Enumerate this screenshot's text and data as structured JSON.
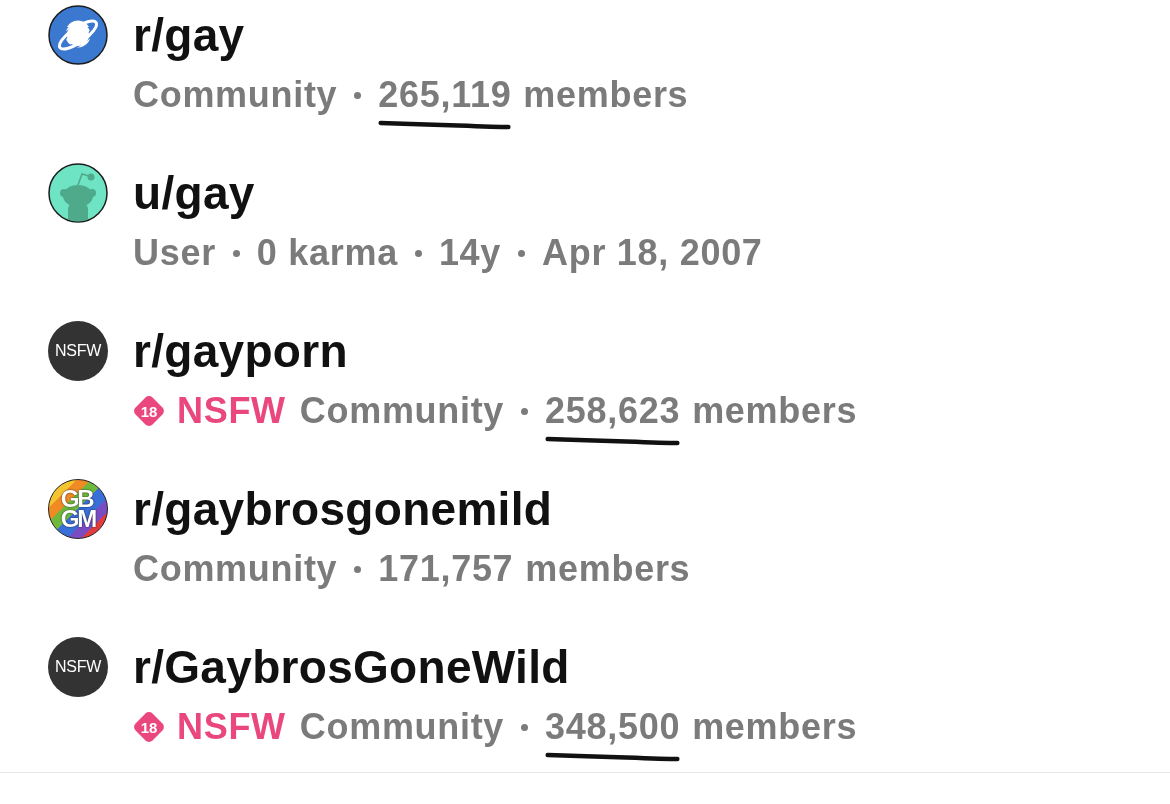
{
  "results": [
    {
      "avatar": {
        "kind": "planet"
      },
      "name": "r/gay",
      "meta": [
        {
          "kind": "text",
          "text": "Community"
        },
        {
          "kind": "count",
          "value": "265,119",
          "unit": "members",
          "underlined": true
        }
      ]
    },
    {
      "avatar": {
        "kind": "mascot"
      },
      "name": "u/gay",
      "meta": [
        {
          "kind": "text",
          "text": "User"
        },
        {
          "kind": "text",
          "text": "0 karma"
        },
        {
          "kind": "text",
          "text": "14y"
        },
        {
          "kind": "text",
          "text": "Apr 18, 2007"
        }
      ]
    },
    {
      "avatar": {
        "kind": "label",
        "text": "NSFW"
      },
      "name": "r/gayporn",
      "nsfw": {
        "age": "18",
        "label": "NSFW"
      },
      "meta": [
        {
          "kind": "text",
          "text": "Community"
        },
        {
          "kind": "count",
          "value": "258,623",
          "unit": "members",
          "underlined": true
        }
      ]
    },
    {
      "avatar": {
        "kind": "letters",
        "lines": [
          "GB",
          "GM"
        ]
      },
      "name": "r/gaybrosgonemild",
      "meta": [
        {
          "kind": "text",
          "text": "Community"
        },
        {
          "kind": "count",
          "value": "171,757",
          "unit": "members",
          "underlined": false
        }
      ]
    },
    {
      "avatar": {
        "kind": "label",
        "text": "NSFW"
      },
      "name": "r/GaybrosGoneWild",
      "nsfw": {
        "age": "18",
        "label": "NSFW"
      },
      "meta": [
        {
          "kind": "text",
          "text": "Community"
        },
        {
          "kind": "count",
          "value": "348,500",
          "unit": "members",
          "underlined": true
        }
      ]
    }
  ]
}
